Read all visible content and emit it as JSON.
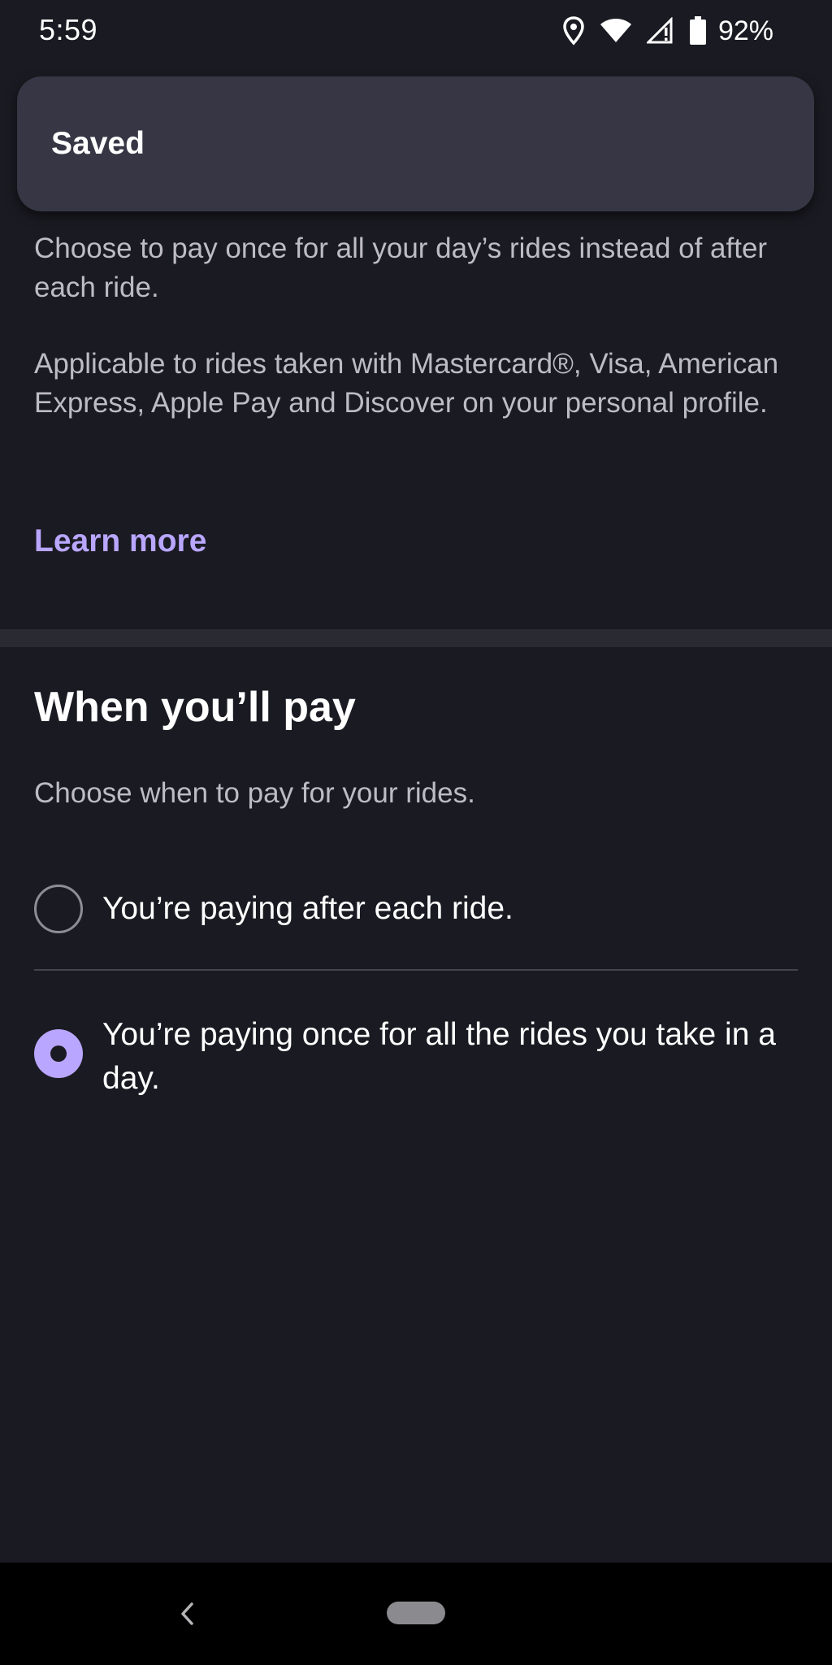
{
  "status_bar": {
    "time": "5:59",
    "battery_percent": "92%",
    "icons": [
      "location-icon",
      "wifi-icon",
      "cellular-signal-icon",
      "battery-icon"
    ]
  },
  "toast": {
    "message": "Saved"
  },
  "description": {
    "paragraph_1": "Choose to pay once for all your day’s rides instead of after each ride.",
    "paragraph_2": "Applicable to rides taken with Mastercard®, Visa, American Express, Apple Pay and Discover on your personal profile.",
    "learn_more": "Learn more"
  },
  "payment_timing": {
    "title": "When you’ll pay",
    "subtitle": "Choose when to pay for your rides.",
    "options": [
      {
        "label": "You’re paying after each ride.",
        "selected": false
      },
      {
        "label": "You’re paying once for all the rides you take in a day.",
        "selected": true
      }
    ]
  },
  "nav_bar": {
    "icons": [
      "back-icon",
      "home-pill-icon"
    ]
  },
  "colors": {
    "background": "#1a1a22",
    "toast": "#363645",
    "accent": "#b9a6ff",
    "muted_text": "#bdbcc4",
    "divider": "#2a2a33"
  }
}
